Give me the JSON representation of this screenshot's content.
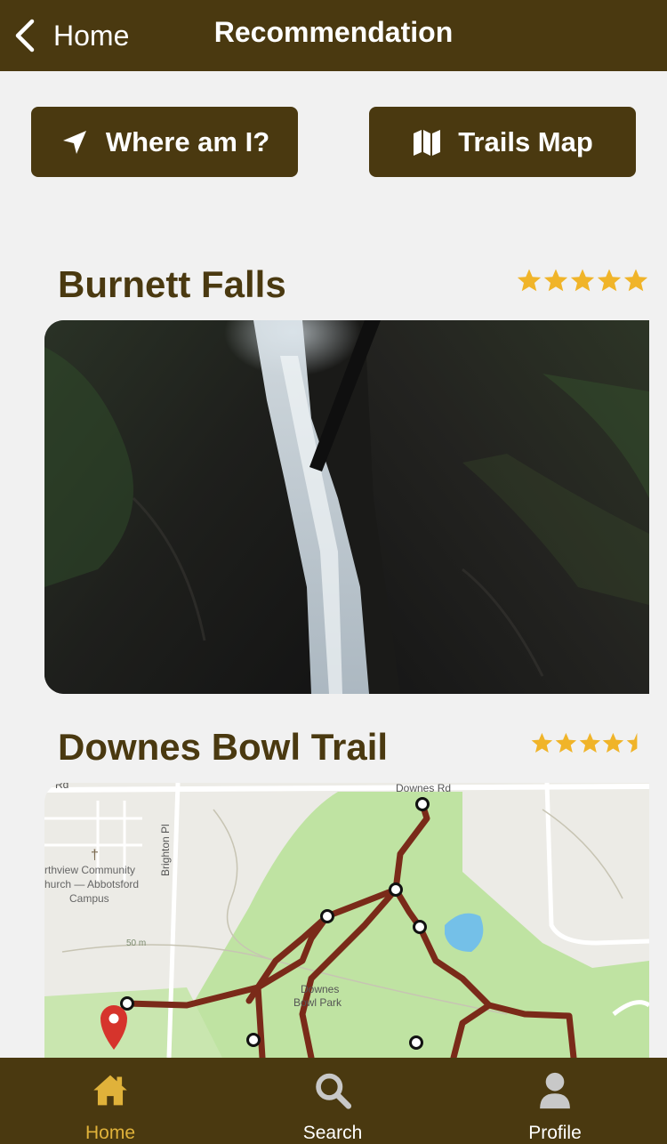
{
  "header": {
    "back_label": "Home",
    "title": "Recommendation"
  },
  "actions": {
    "where_label": "Where am I?",
    "map_label": "Trails Map"
  },
  "recommendations": [
    {
      "name": "Burnett Falls",
      "rating": 5,
      "image_icon": "waterfall-photo"
    },
    {
      "name": "Downes Bowl Trail",
      "rating": 4.5,
      "image_icon": "trail-map",
      "map_labels": {
        "road_top": "Downes Rd",
        "road_top_left": "Rd",
        "street_vertical": "Brighton Pl",
        "church": "rthview Community\nhurch — Abbotsford\nCampus",
        "park": "Downes\nBowl Park",
        "elevation": "50 m"
      }
    }
  ],
  "tabs": [
    {
      "label": "Home",
      "icon": "home-icon",
      "active": true
    },
    {
      "label": "Search",
      "icon": "search-icon",
      "active": false
    },
    {
      "label": "Profile",
      "icon": "profile-icon",
      "active": false
    }
  ],
  "colors": {
    "brand": "#4a3910",
    "star": "#f0b429",
    "active_tab": "#e0b23a",
    "background": "#f1f1f1"
  }
}
